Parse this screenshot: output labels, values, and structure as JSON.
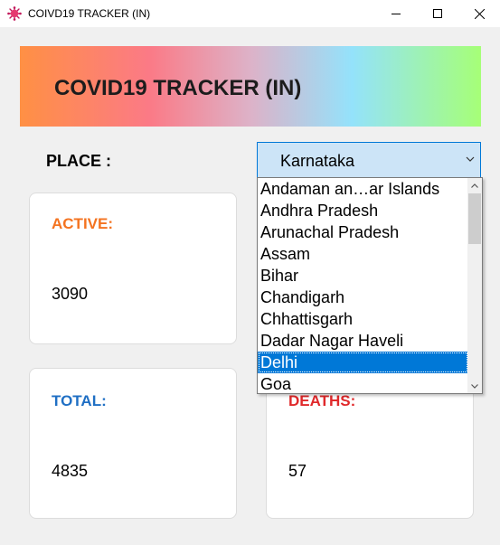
{
  "window": {
    "title": "COIVD19 TRACKER (IN)"
  },
  "banner": {
    "title": "COVID19 TRACKER (IN)"
  },
  "place": {
    "label": "PLACE :",
    "selected": "Karnataka"
  },
  "dropdown": {
    "items": [
      "Andaman an…ar Islands",
      "Andhra Pradesh",
      "Arunachal Pradesh",
      "Assam",
      "Bihar",
      "Chandigarh",
      "Chhattisgarh",
      "Dadar Nagar Haveli",
      "Delhi",
      "Goa"
    ],
    "highlighted": "Delhi",
    "scroll_position": 0.0
  },
  "cards": {
    "active": {
      "label": "ACTIVE:",
      "value": "3090",
      "color": "#f47320"
    },
    "total": {
      "label": "TOTAL:",
      "value": "4835",
      "color": "#1f6fc4"
    },
    "deaths": {
      "label": "DEATHS:",
      "value": "57",
      "color": "#e0292b"
    }
  },
  "icons": {
    "app": "virus-icon",
    "minimize": "minimize-icon",
    "maximize": "maximize-icon",
    "close": "close-icon",
    "select_arrow": "chevron-down-icon"
  }
}
